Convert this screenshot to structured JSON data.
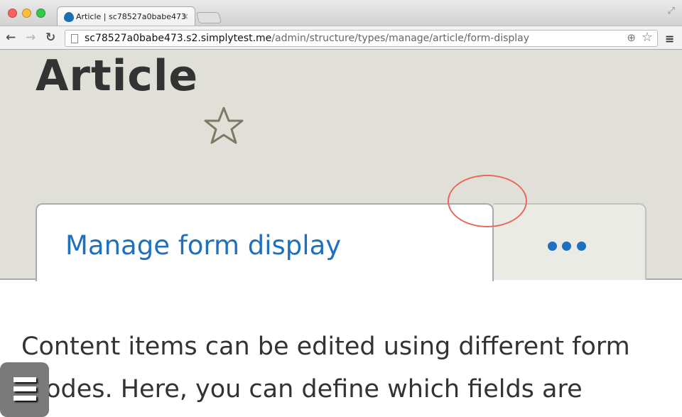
{
  "browser": {
    "tab_title": "Article | sc78527a0babe473",
    "tab_close": "×",
    "url_host": "sc78527a0babe473.s2.simplytest.me",
    "url_path": "/admin/structure/types/manage/article/form-display"
  },
  "page": {
    "title": "Article",
    "tabs": [
      {
        "label": "Manage form display",
        "active": true
      },
      {
        "label": "More tabs",
        "icon": "ellipsis-icon"
      }
    ],
    "description": "Content items can be edited using different form modes. Here, you can define which fields are"
  },
  "colors": {
    "link": "#1f70bf",
    "annotation": "#e8685a",
    "page_bg": "#e1e0d8"
  }
}
